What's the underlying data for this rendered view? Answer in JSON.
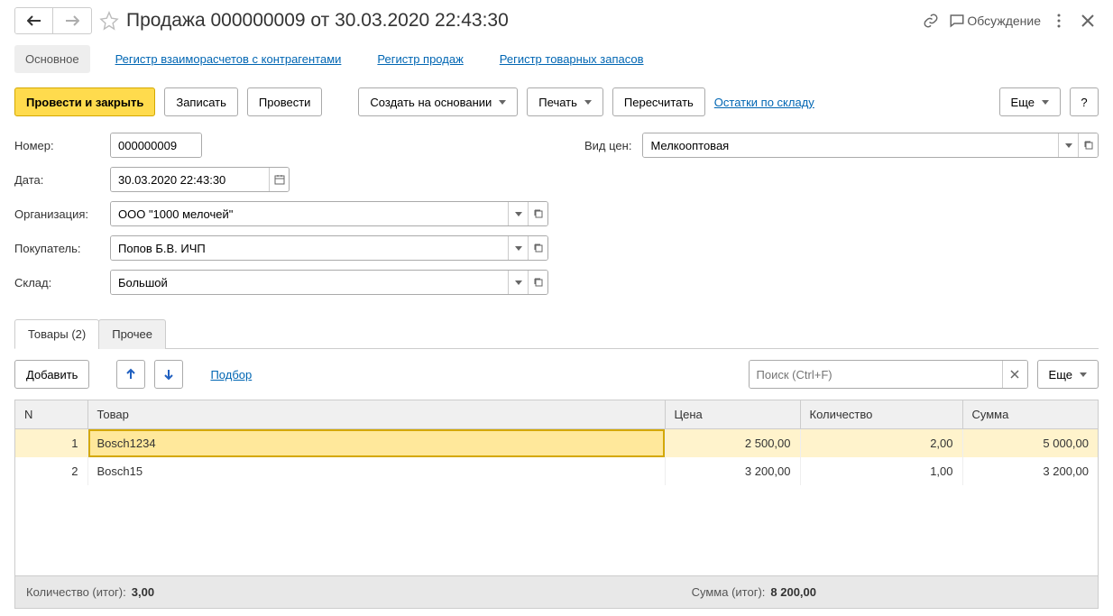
{
  "header": {
    "title": "Продажа 000000009 от 30.03.2020 22:43:30",
    "discuss": "Обсуждение"
  },
  "nav": {
    "main": "Основное",
    "register_settlements": "Регистр взаиморасчетов с контрагентами",
    "register_sales": "Регистр продаж",
    "register_stock": "Регистр товарных запасов"
  },
  "toolbar": {
    "post_close": "Провести и закрыть",
    "save": "Записать",
    "post": "Провести",
    "create_based": "Создать на основании",
    "print": "Печать",
    "recalc": "Пересчитать",
    "stock_link": "Остатки по складу",
    "more": "Еще",
    "help": "?"
  },
  "fields": {
    "number_label": "Номер:",
    "number_value": "000000009",
    "date_label": "Дата:",
    "date_value": "30.03.2020 22:43:30",
    "org_label": "Организация:",
    "org_value": "ООО \"1000 мелочей\"",
    "buyer_label": "Покупатель:",
    "buyer_value": "Попов Б.В. ИЧП",
    "warehouse_label": "Склад:",
    "warehouse_value": "Большой",
    "pricetype_label": "Вид цен:",
    "pricetype_value": "Мелкооптовая"
  },
  "tabs": {
    "goods": "Товары (2)",
    "other": "Прочее"
  },
  "table_toolbar": {
    "add": "Добавить",
    "pick": "Подбор",
    "search_placeholder": "Поиск (Ctrl+F)",
    "more": "Еще"
  },
  "table": {
    "columns": {
      "n": "N",
      "product": "Товар",
      "price": "Цена",
      "qty": "Количество",
      "sum": "Сумма"
    },
    "rows": [
      {
        "n": "1",
        "product": "Bosch1234",
        "price": "2 500,00",
        "qty": "2,00",
        "sum": "5 000,00"
      },
      {
        "n": "2",
        "product": "Bosch15",
        "price": "3 200,00",
        "qty": "1,00",
        "sum": "3 200,00"
      }
    ]
  },
  "footer": {
    "qty_label": "Количество (итог):",
    "qty_value": "3,00",
    "sum_label": "Сумма (итог):",
    "sum_value": "8 200,00"
  }
}
